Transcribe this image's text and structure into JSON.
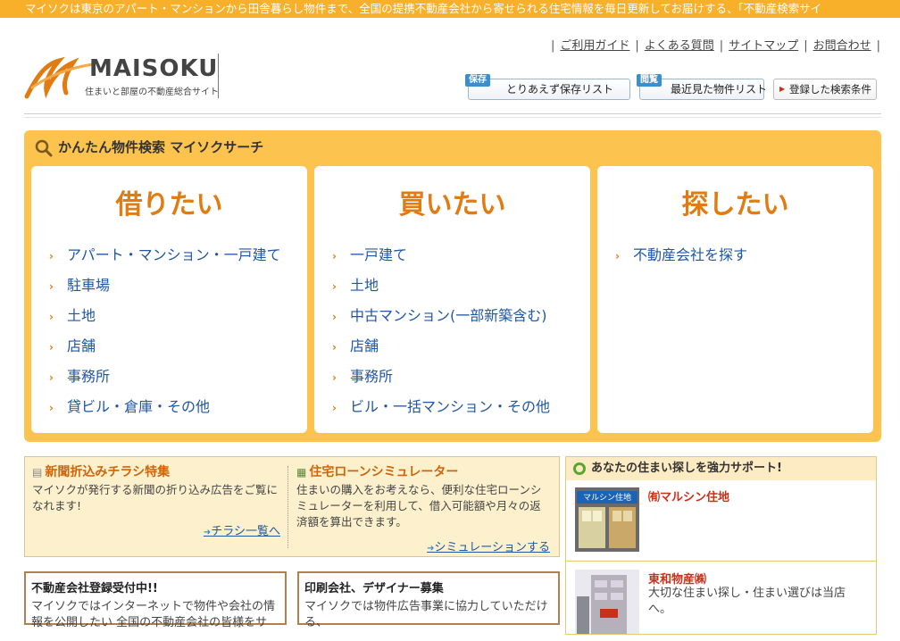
{
  "top_banner": "マイソクは東京のアパート・マンションから田舎暮らし物件まで、全国の提携不動産会社から寄せられる住宅情報を毎日更新してお届けする、「不動産検索サイ",
  "logo": {
    "name": "MAISOKU",
    "tagline": "住まいと部屋の不動産総合サイト"
  },
  "top_links": [
    "ご利用ガイド",
    "よくある質問",
    "サイトマップ",
    "お問合わせ"
  ],
  "header_buttons": {
    "save_tag": "保存",
    "save_label": "とりあえず保存リスト",
    "viewed_tag": "閲覧",
    "viewed_label": "最近見た物件リスト",
    "search_label": "登録した検索条件"
  },
  "search": {
    "title": "かんたん物件検索 マイソクサーチ",
    "columns": [
      {
        "heading": "借りたい",
        "items": [
          "アパート・マンション・一戸建て",
          "駐車場",
          "土地",
          "店舗",
          "事務所",
          "貸ビル・倉庫・その他"
        ]
      },
      {
        "heading": "買いたい",
        "items": [
          "一戸建て",
          "土地",
          "中古マンション(一部新築含む)",
          "店舗",
          "事務所",
          "ビル・一括マンション・その他"
        ]
      },
      {
        "heading": "探したい",
        "items": [
          "不動産会社を探す"
        ]
      }
    ]
  },
  "flyer": {
    "title": "新聞折込みチラシ特集",
    "text": "マイソクが発行する新聞の折り込み広告をご覧になれます!",
    "link": "チラシ一覧へ"
  },
  "loan": {
    "title": "住宅ローンシミュレーター",
    "text": "住まいの購入をお考えなら、便利な住宅ローンシミュレーターを利用して、借入可能額や月々の返済額を算出できます。",
    "link": "シミュレーションする"
  },
  "recruit1": {
    "title": "不動産会社登録受付中!!",
    "text": "マイソクではインターネットで物件や会社の情報を公開したい 全国の不動産会社の皆様をサ"
  },
  "recruit2": {
    "title": "印刷会社、デザイナー募集",
    "text": "マイソクでは物件広告事業に協力していただける、"
  },
  "support": {
    "title": "あなたの住まい探しを強力サポート!",
    "items": [
      {
        "name": "㈲マルシン住地",
        "desc": "",
        "sign": "マルシン住地"
      },
      {
        "name": "東和物産㈱",
        "desc": "大切な住まい探し・住まい選びは当店へ。"
      }
    ]
  },
  "colors": {
    "accent": "#fcc44f",
    "heading": "#e07c12",
    "link": "#1f57a3",
    "banner": "#f8b02a"
  }
}
